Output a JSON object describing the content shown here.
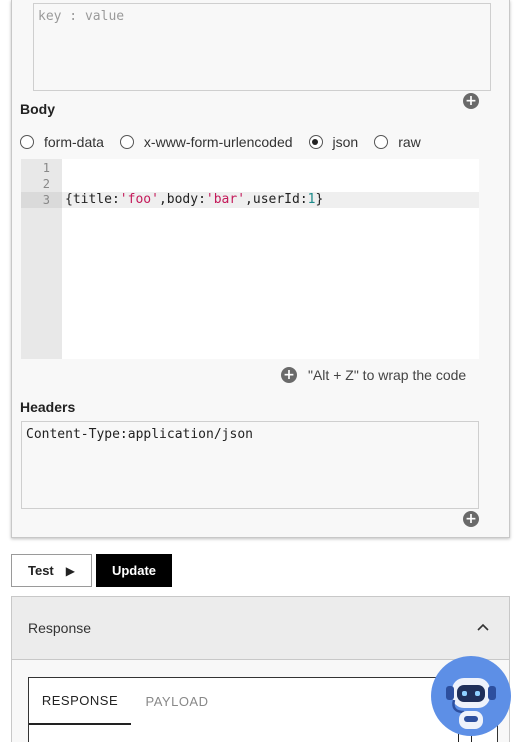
{
  "params_field": {
    "placeholder": "key : value"
  },
  "body": {
    "label": "Body",
    "options": [
      {
        "label": "form-data",
        "selected": false
      },
      {
        "label": "x-www-form-urlencoded",
        "selected": false
      },
      {
        "label": "json",
        "selected": true
      },
      {
        "label": "raw",
        "selected": false
      }
    ],
    "editor": {
      "line_numbers": [
        "1",
        "2",
        "3"
      ],
      "code": {
        "open": "{title:",
        "title_val": "'foo'",
        "sep1": ",body:",
        "body_val": "'bar'",
        "sep2": ",userId:",
        "userId_val": "1",
        "close": "}"
      }
    },
    "wrap_hint": "\"Alt + Z\" to wrap the code"
  },
  "headers": {
    "label": "Headers",
    "value": "Content-Type:application/json"
  },
  "actions": {
    "test_label": "Test",
    "update_label": "Update"
  },
  "response": {
    "title": "Response",
    "tabs": [
      {
        "label": "RESPONSE",
        "active": true
      },
      {
        "label": "PAYLOAD",
        "active": false
      }
    ]
  },
  "colors": {
    "accent": "#000000",
    "bot": "#5d8fe6",
    "string": "#c41a5a",
    "number": "#1a8a8a"
  },
  "icons": {
    "add": "plus-circle-icon",
    "play": "play-icon",
    "collapse": "chevron-up-icon",
    "copy": "copy-icon",
    "assistant": "robot-icon"
  }
}
